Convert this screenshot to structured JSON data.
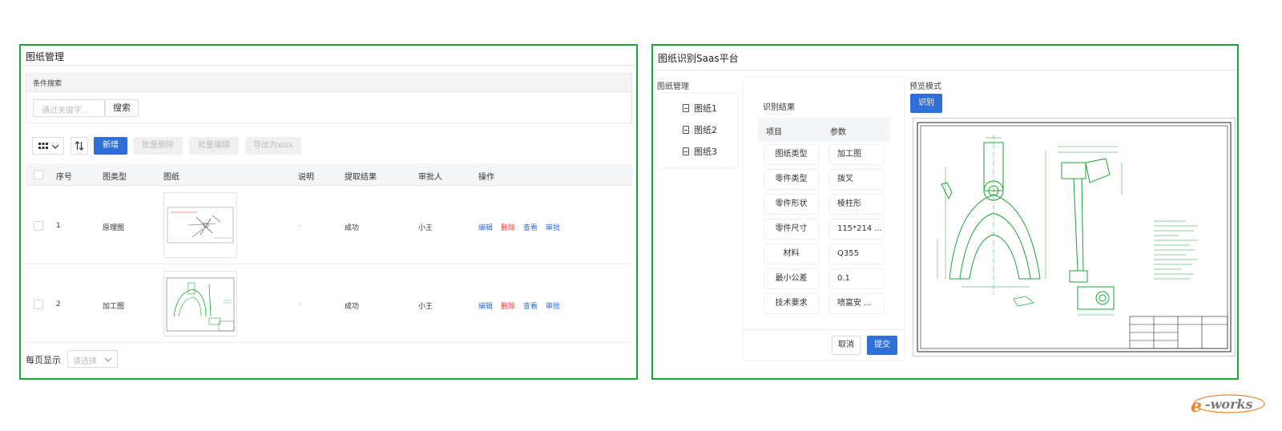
{
  "left": {
    "title": "图纸管理",
    "search": {
      "header": "条件搜索",
      "placeholder": "通过关键字...",
      "button": "搜索"
    },
    "toolbar": {
      "add": "新增",
      "batch_delete": "批量删除",
      "batch_edit": "批量编辑",
      "export": "导出为xlsx"
    },
    "table": {
      "headers": [
        "序号",
        "图类型",
        "图纸",
        "说明",
        "提取结果",
        "审批人",
        "操作"
      ],
      "rows": [
        {
          "index": "1",
          "type": "原理图",
          "desc": "-",
          "result": "成功",
          "approver": "小王"
        },
        {
          "index": "2",
          "type": "加工图",
          "desc": "-",
          "result": "成功",
          "approver": "小王"
        }
      ],
      "actions": {
        "edit": "编辑",
        "delete": "删除",
        "view": "查看",
        "approve": "审批"
      }
    },
    "pager": {
      "label": "每页显示",
      "placeholder": "请选择"
    }
  },
  "right": {
    "title": "图纸识别Saas平台",
    "tree": {
      "title": "图纸管理",
      "items": [
        "图纸1",
        "图纸2",
        "图纸3"
      ]
    },
    "result": {
      "title": "识别结果",
      "headers": [
        "项目",
        "参数"
      ],
      "rows": [
        {
          "label": "图纸类型",
          "value": "加工图"
        },
        {
          "label": "零件类型",
          "value": "拨叉"
        },
        {
          "label": "零件形状",
          "value": "棱柱形"
        },
        {
          "label": "零件尺寸",
          "value": "115*214 ..."
        },
        {
          "label": "材料",
          "value": "Q355"
        },
        {
          "label": "最小公差",
          "value": "0.1"
        },
        {
          "label": "技术要求",
          "value": "喷富安 ..."
        }
      ],
      "cancel": "取消",
      "submit": "提交"
    },
    "preview": {
      "title": "预览模式",
      "button": "识别"
    }
  },
  "watermark": "e-works",
  "colors": {
    "frame": "#22a33a",
    "primary": "#2f6fd8",
    "danger": "#e23b3b",
    "drawing": "#1aa534"
  }
}
